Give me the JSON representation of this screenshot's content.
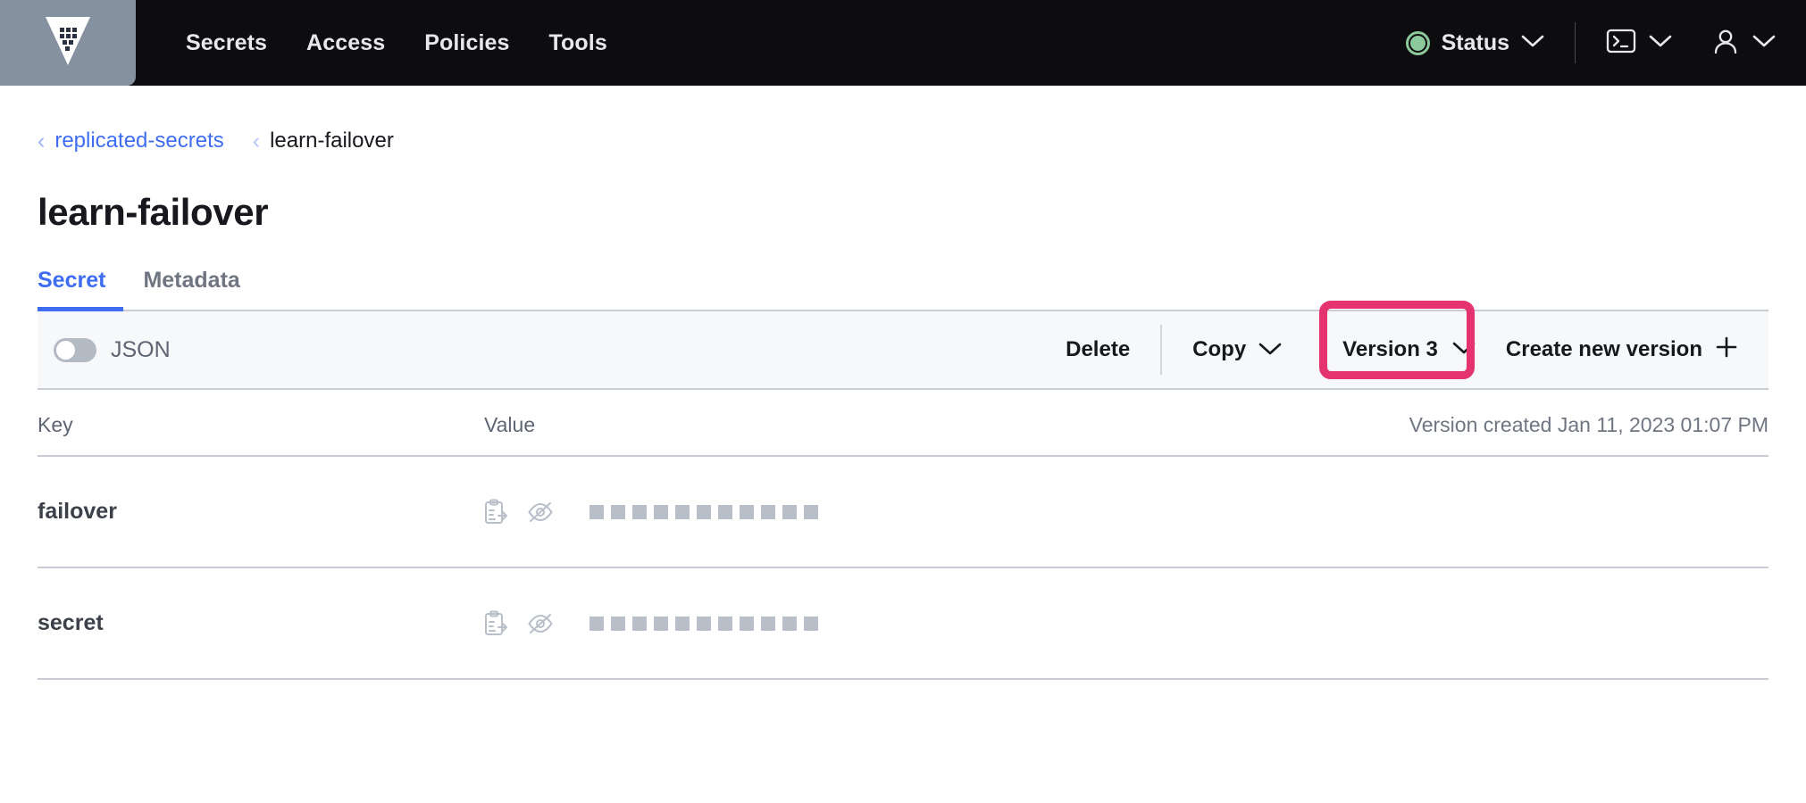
{
  "navbar": {
    "logo_icon": "vault-logo-icon",
    "links": [
      {
        "label": "Secrets"
      },
      {
        "label": "Access"
      },
      {
        "label": "Policies"
      },
      {
        "label": "Tools"
      }
    ],
    "status": {
      "label": "Status",
      "indicator_color": "#8bc99a",
      "chevron_icon": "chevron-down-icon"
    },
    "console_menu": {
      "icon": "terminal-icon",
      "chevron_icon": "chevron-down-icon"
    },
    "user_menu": {
      "icon": "user-icon",
      "chevron_icon": "chevron-down-icon"
    }
  },
  "breadcrumb": {
    "parent_caret": "‹",
    "parent": "replicated-secrets",
    "current_caret": "‹",
    "current": "learn-failover"
  },
  "page": {
    "title": "learn-failover"
  },
  "tabs": [
    {
      "label": "Secret",
      "active": true
    },
    {
      "label": "Metadata",
      "active": false
    }
  ],
  "toolbar": {
    "json_toggle": {
      "label": "JSON",
      "enabled": false
    },
    "delete_label": "Delete",
    "copy_label": "Copy",
    "copy_chevron_icon": "chevron-down-icon",
    "version_label": "Version 3",
    "version_chevron_icon": "chevron-down-icon",
    "create_version_label": "Create new version",
    "create_version_icon": "plus-icon",
    "highlight_color": "#e4336f"
  },
  "table": {
    "headers": {
      "key": "Key",
      "value": "Value"
    },
    "version_created": "Version created Jan 11, 2023 01:07 PM",
    "masked_char_count": 11,
    "rows": [
      {
        "key": "failover",
        "copy_icon": "copy-to-clipboard-icon",
        "reveal_icon": "eye-off-icon",
        "value_masked": true
      },
      {
        "key": "secret",
        "copy_icon": "copy-to-clipboard-icon",
        "reveal_icon": "eye-off-icon",
        "value_masked": true
      }
    ]
  }
}
